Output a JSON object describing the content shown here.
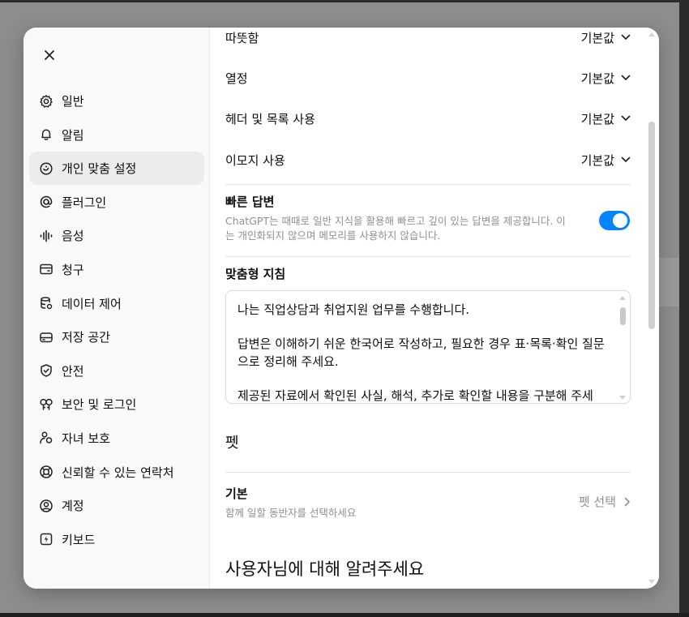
{
  "sidebar": {
    "items": [
      {
        "label": "일반",
        "icon": "gear-icon"
      },
      {
        "label": "알림",
        "icon": "bell-icon"
      },
      {
        "label": "개인 맞춤 설정",
        "icon": "personalization-icon",
        "active": true
      },
      {
        "label": "플러그인",
        "icon": "at-sign-icon"
      },
      {
        "label": "음성",
        "icon": "waveform-icon"
      },
      {
        "label": "청구",
        "icon": "credit-card-icon"
      },
      {
        "label": "데이터 제어",
        "icon": "database-icon"
      },
      {
        "label": "저장 공간",
        "icon": "storage-icon"
      },
      {
        "label": "안전",
        "icon": "shield-check-icon"
      },
      {
        "label": "보안 및 로그인",
        "icon": "key-icon"
      },
      {
        "label": "자녀 보호",
        "icon": "family-icon"
      },
      {
        "label": "신뢰할 수 있는 연락처",
        "icon": "lifebuoy-icon"
      },
      {
        "label": "계정",
        "icon": "account-icon"
      },
      {
        "label": "키보드",
        "icon": "keyboard-icon"
      }
    ]
  },
  "settings": {
    "warmth": {
      "label": "따뜻함",
      "value": "기본값"
    },
    "enthusiasm": {
      "label": "열정",
      "value": "기본값"
    },
    "headers_lists": {
      "label": "헤더 및 목록 사용",
      "value": "기본값"
    },
    "emoji": {
      "label": "이모지 사용",
      "value": "기본값"
    }
  },
  "quick_answers": {
    "title": "빠른 답변",
    "description": "ChatGPT는 때때로 일반 지식을 활용해 빠르고 깊이 있는 답변을 제공합니다. 이는 개인화되지 않으며 메모리를 사용하지 않습니다.",
    "enabled": true
  },
  "custom_instructions": {
    "title": "맞춤형 지침",
    "paragraph1": "나는 직업상담과 취업지원 업무를 수행합니다.",
    "paragraph2": "답변은 이해하기 쉬운 한국어로 작성하고, 필요한 경우 표·목록·확인 질문으로 정리해 주세요.",
    "paragraph3": "제공된 자료에서 확인된 사실, 해석, 추가로 확인할 내용을 구분해 주세요."
  },
  "pet": {
    "heading": "펫",
    "title": "기본",
    "description": "함께 일할 동반자를 선택하세요",
    "select_label": "펫 선택"
  },
  "about_you": {
    "heading": "사용자님에 대해 알려주세요"
  },
  "colors": {
    "toggle_on": "#0285ff",
    "active_nav_bg": "#ececec"
  }
}
